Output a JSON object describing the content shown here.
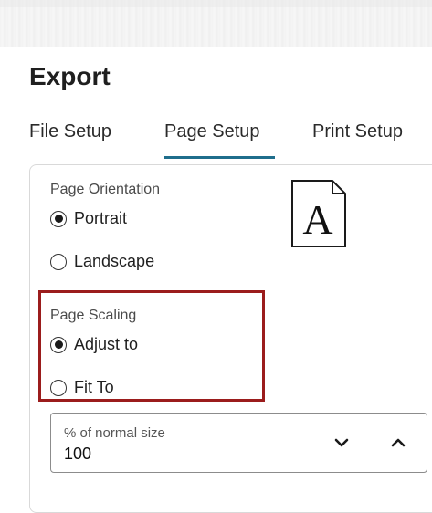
{
  "dialog": {
    "title": "Export"
  },
  "tabs": [
    {
      "label": "File Setup"
    },
    {
      "label": "Page Setup",
      "selected": true
    },
    {
      "label": "Print Setup"
    }
  ],
  "page_orientation": {
    "label": "Page Orientation",
    "options": [
      {
        "label": "Portrait",
        "checked": true
      },
      {
        "label": "Landscape",
        "checked": false
      }
    ],
    "icon": "document-a-icon"
  },
  "page_scaling": {
    "label": "Page Scaling",
    "options": [
      {
        "label": "Adjust to",
        "checked": true
      },
      {
        "label": "Fit To",
        "checked": false
      }
    ],
    "highlight_color": "#9b1c1c"
  },
  "scale_stepper": {
    "label": "% of normal size",
    "value": "100",
    "decrement_icon": "chevron-down-icon",
    "increment_icon": "chevron-up-icon"
  },
  "colors": {
    "accent": "#1f6e8c"
  },
  "doc_icon_letter": "A"
}
